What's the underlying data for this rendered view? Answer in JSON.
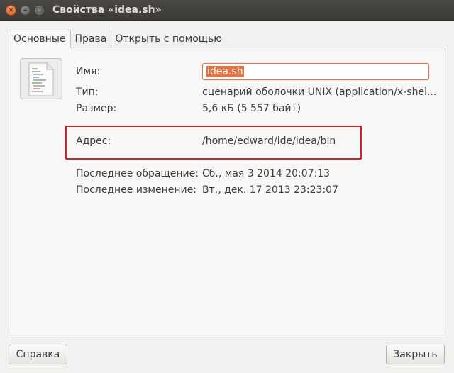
{
  "window": {
    "title": "Свойства «idea.sh»",
    "controls": {
      "close": "×",
      "minimize": "–",
      "maximize": "□"
    }
  },
  "tabs": [
    {
      "label": "Основные",
      "active": true
    },
    {
      "label": "Права",
      "active": false
    },
    {
      "label": "Открыть с помощью",
      "active": false
    }
  ],
  "file": {
    "icon": "shell-script-file-icon",
    "name_label": "Имя:",
    "name_value": "idea.sh",
    "type_label": "Тип:",
    "type_value": "сценарий оболочки UNIX (application/x-shel...",
    "size_label": "Размер:",
    "size_value": "5,6 кБ (5 557 байт)",
    "location_label": "Адрес:",
    "location_value": "/home/edward/ide/idea/bin",
    "accessed_label": "Последнее обращение:",
    "accessed_value": "Сб., мая  3 2014 20:07:13",
    "modified_label": "Последнее изменение:",
    "modified_value": "Вт., дек. 17 2013 23:23:07"
  },
  "buttons": {
    "help_label": "Справка",
    "close_label": "Закрыть"
  },
  "colors": {
    "titlebar": "#3c3b37",
    "accent_selection": "#e9733f",
    "highlight_border": "#d5202a"
  }
}
